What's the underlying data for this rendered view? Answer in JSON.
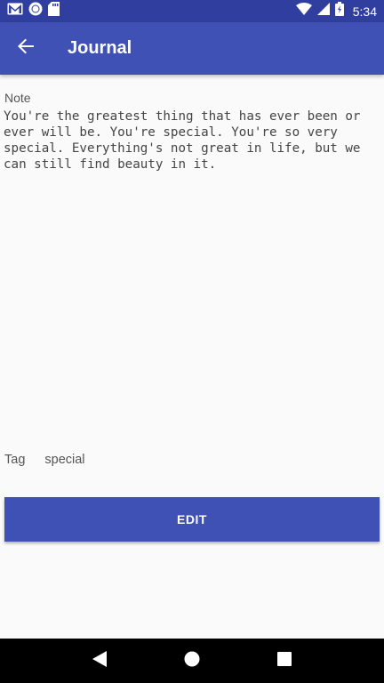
{
  "status_bar": {
    "time": "5:34",
    "icons": [
      "gmail-icon",
      "circle-app-icon",
      "sd-card-icon",
      "wifi-icon",
      "signal-icon",
      "battery-icon"
    ]
  },
  "app_bar": {
    "title": "Journal",
    "back_icon": "arrow-back-icon",
    "color": "#3f51b5"
  },
  "note": {
    "label": "Note",
    "text": "You're the greatest thing that has ever been or ever will be. You're special. You're so very special. Everything's not great in life, but we can still find beauty in it."
  },
  "tag": {
    "label": "Tag",
    "value": "special"
  },
  "actions": {
    "edit_label": "EDIT"
  },
  "nav_bar": {
    "icons": [
      "back-triangle-icon",
      "home-circle-icon",
      "recents-square-icon"
    ]
  }
}
